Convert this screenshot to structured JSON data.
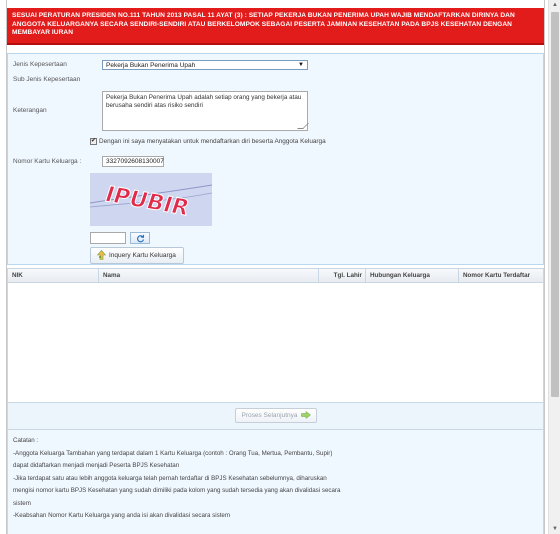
{
  "banner": {
    "text": "SESUAI PERATURAN PRESIDEN NO.111 TAHUN 2013 PASAL 11 AYAT (3) : SETIAP PEKERJA BUKAN PENERIMA UPAH WAJIB MENDAFTARKAN DIRINYA DAN ANGGOTA KELUARGANYA SECARA SENDIRI-SENDIRI ATAU BERKELOMPOK SEBAGAI PESERTA JAMINAN KESEHATAN PADA BPJS KESEHATAN DENGAN MEMBAYAR IURAN"
  },
  "form": {
    "jenis_label": "Jenis Kepesertaan",
    "jenis_value": "Pekerja Bukan Penerima Upah",
    "sub_label": "Sub Jenis Kepesertaan",
    "keterangan_label": "Keterangan",
    "keterangan_text": "Pekerja Bukan Penerima Upah adalah setiap orang yang bekerja atau berusaha sendiri atas risiko sendiri",
    "checkbox_label": "Dengan ini saya menyatakan untuk mendaftarkan diri beserta Anggota Keluarga",
    "kk_label": "Nomor Kartu Keluarga :",
    "kk_value": "3327092608130007",
    "captcha_text": "IPUBIR",
    "inquiry_label": "Inquery Kartu Keluarga"
  },
  "grid": {
    "columns": [
      "NIK",
      "Nama",
      "Tgl. Lahir",
      "Hubungan Keluarga",
      "Nomor Kartu Terdaftar"
    ]
  },
  "proses_label": "Proses Selanjutnya",
  "notes": {
    "title": "Catatan :",
    "lines": [
      "-Anggota Keluarga Tambahan yang terdapat dalam 1 Kartu Keluarga (contoh : Orang Tua, Mertua, Pembantu, Supir)",
      "dapat didaftarkan menjadi menjadi Peserta BPJS Kesehatan",
      "-Jika terdapat satu atau lebih anggota keluarga telah pernah terdaftar di BPJS Kesehatan sebelumnya, diharuskan",
      "mengisi nomor kartu BPJS Kesehatan yang sudah dimiliki pada kolom yang sudah tersedia yang akan divalidasi secara",
      "sistem",
      "-Keabsahan Nomor Kartu Keluarga yang anda isi akan divalidasi secara sistem"
    ]
  },
  "colors": {
    "banner": "#e21b1b",
    "form_bg": "#f0f8ff",
    "captcha_text": "#e02b4b"
  },
  "icons": {
    "inquiry": "plus-arrow-icon",
    "refresh": "refresh-icon",
    "next": "arrow-right-icon"
  }
}
